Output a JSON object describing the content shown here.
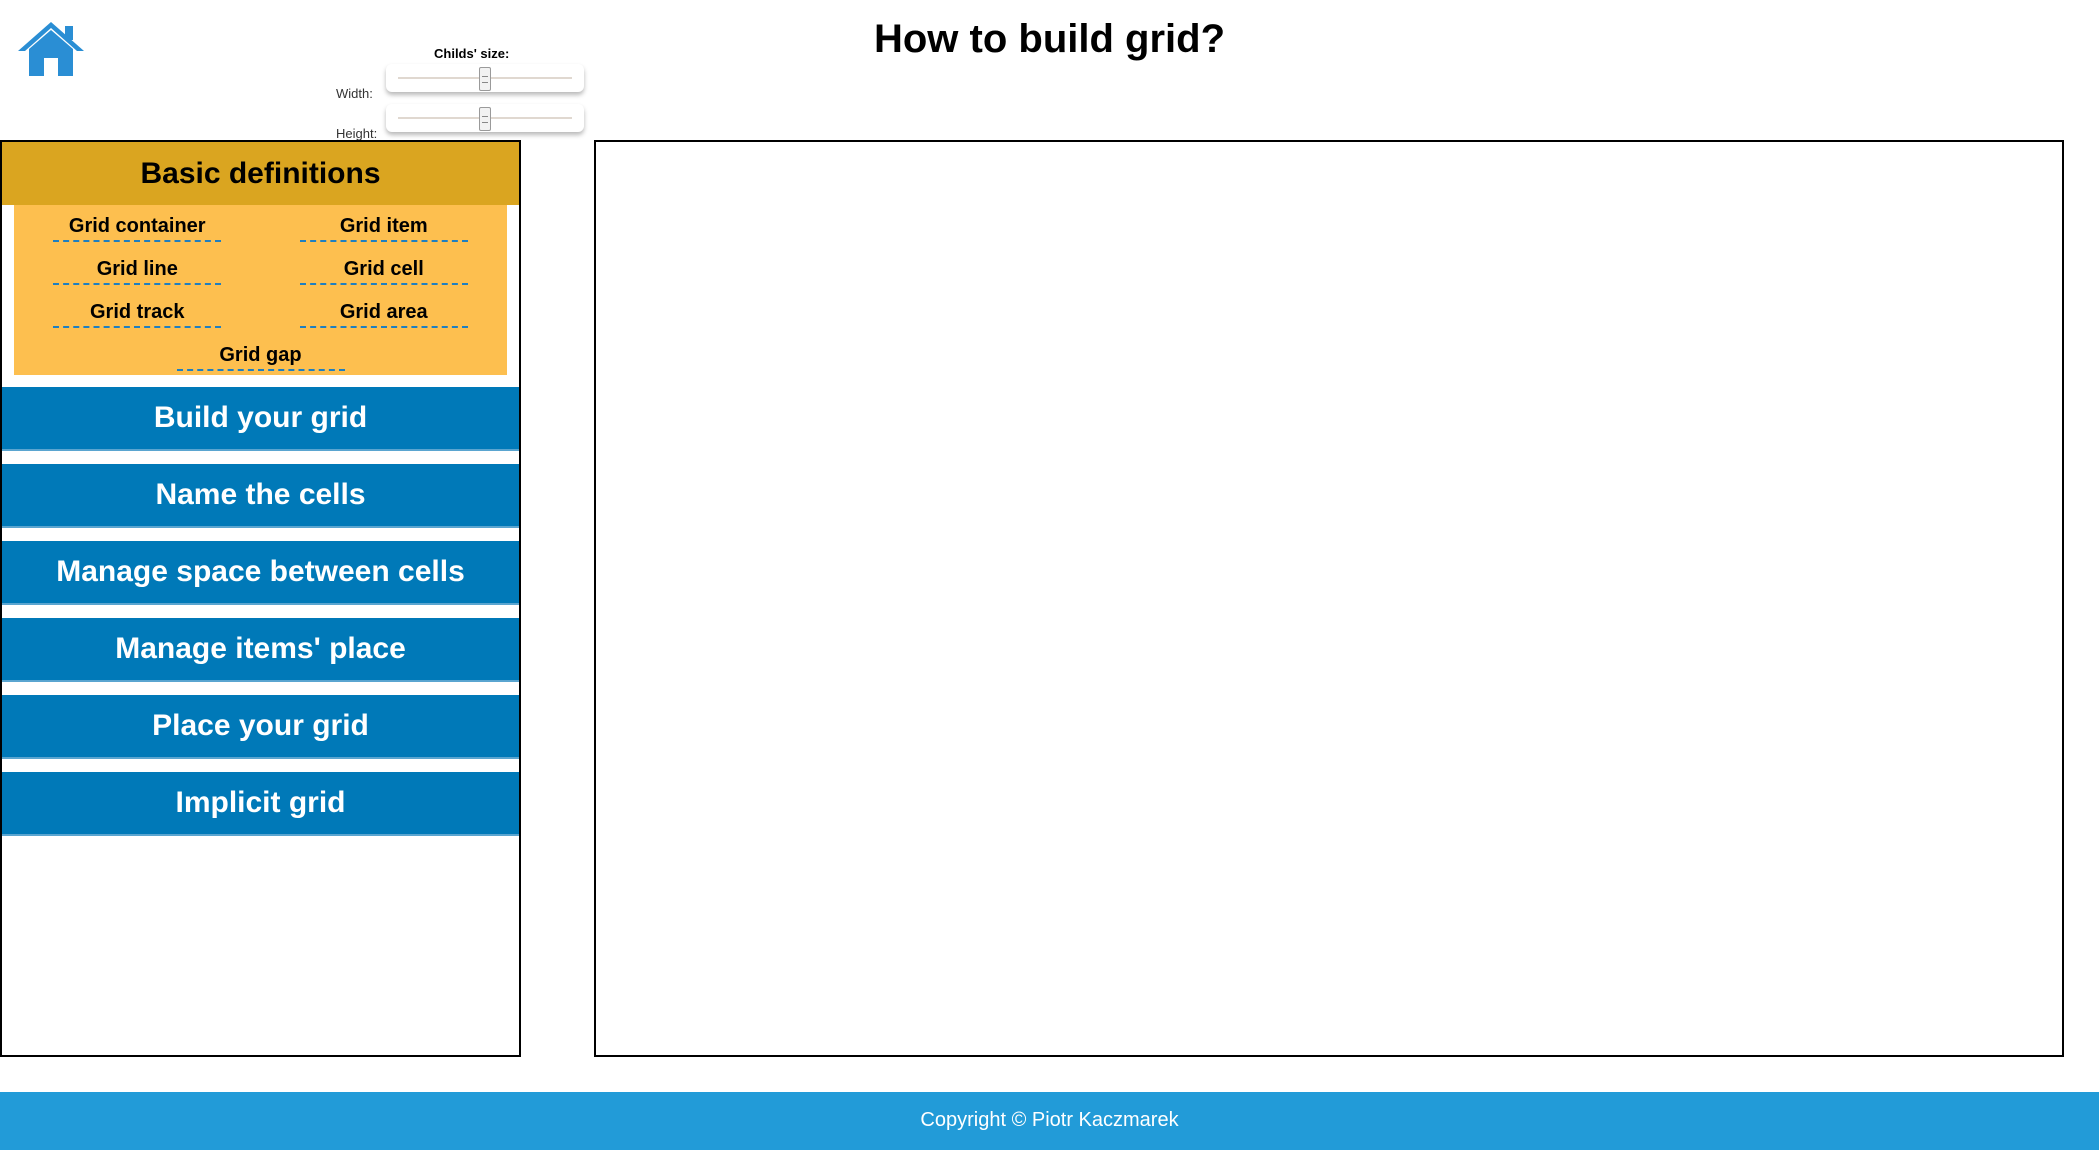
{
  "header": {
    "title": "How to build grid?",
    "home_icon": "home-icon"
  },
  "controls": {
    "size_label": "Childs' size:",
    "width_label": "Width:",
    "height_label": "Height:",
    "width_value": 0.5,
    "height_value": 0.5
  },
  "sidebar": {
    "basic": {
      "title": "Basic definitions",
      "items": [
        "Grid container",
        "Grid item",
        "Grid line",
        "Grid cell",
        "Grid track",
        "Grid area",
        "Grid gap"
      ]
    },
    "menu": [
      "Build your grid",
      "Name the cells",
      "Manage space between cells",
      "Manage items' place",
      "Place your grid",
      "Implicit grid"
    ]
  },
  "footer": {
    "text": "Copyright © Piotr Kaczmarek"
  },
  "colors": {
    "accent_blue": "#0079b8",
    "home_icon_blue": "#2a8ed4",
    "basic_header": "#daa520",
    "basic_panel": "#fdbf4f",
    "footer": "#229bd8",
    "underline": "#1e7fc0"
  }
}
